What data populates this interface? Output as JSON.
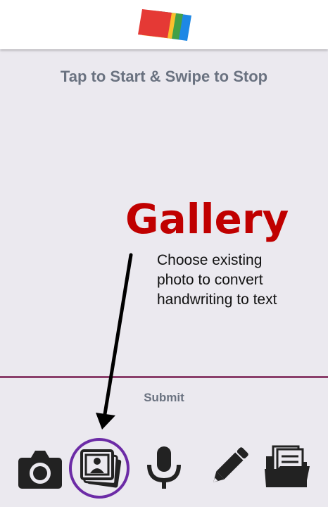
{
  "header": {
    "logo_icon": "stacked-colored-pages-logo",
    "logo_colors": [
      "#e53935",
      "#fbc02d",
      "#43a047",
      "#1e88e5"
    ]
  },
  "main": {
    "instruction": "Tap to Start & Swipe to Stop"
  },
  "callout": {
    "title": "Gallery",
    "description_lines": [
      "Choose existing",
      "photo to convert",
      "handwriting to text"
    ],
    "title_color": "#c00000"
  },
  "actions": {
    "submit_label": "Submit",
    "divider_color": "#8b3f6b"
  },
  "toolbar": {
    "tools": [
      {
        "name": "camera",
        "icon": "camera-icon"
      },
      {
        "name": "gallery",
        "icon": "gallery-icon",
        "highlighted": true
      },
      {
        "name": "voice",
        "icon": "microphone-icon"
      },
      {
        "name": "draw",
        "icon": "pencil-icon"
      },
      {
        "name": "files",
        "icon": "folder-documents-icon"
      }
    ],
    "highlight_color": "#6c2ba6"
  }
}
